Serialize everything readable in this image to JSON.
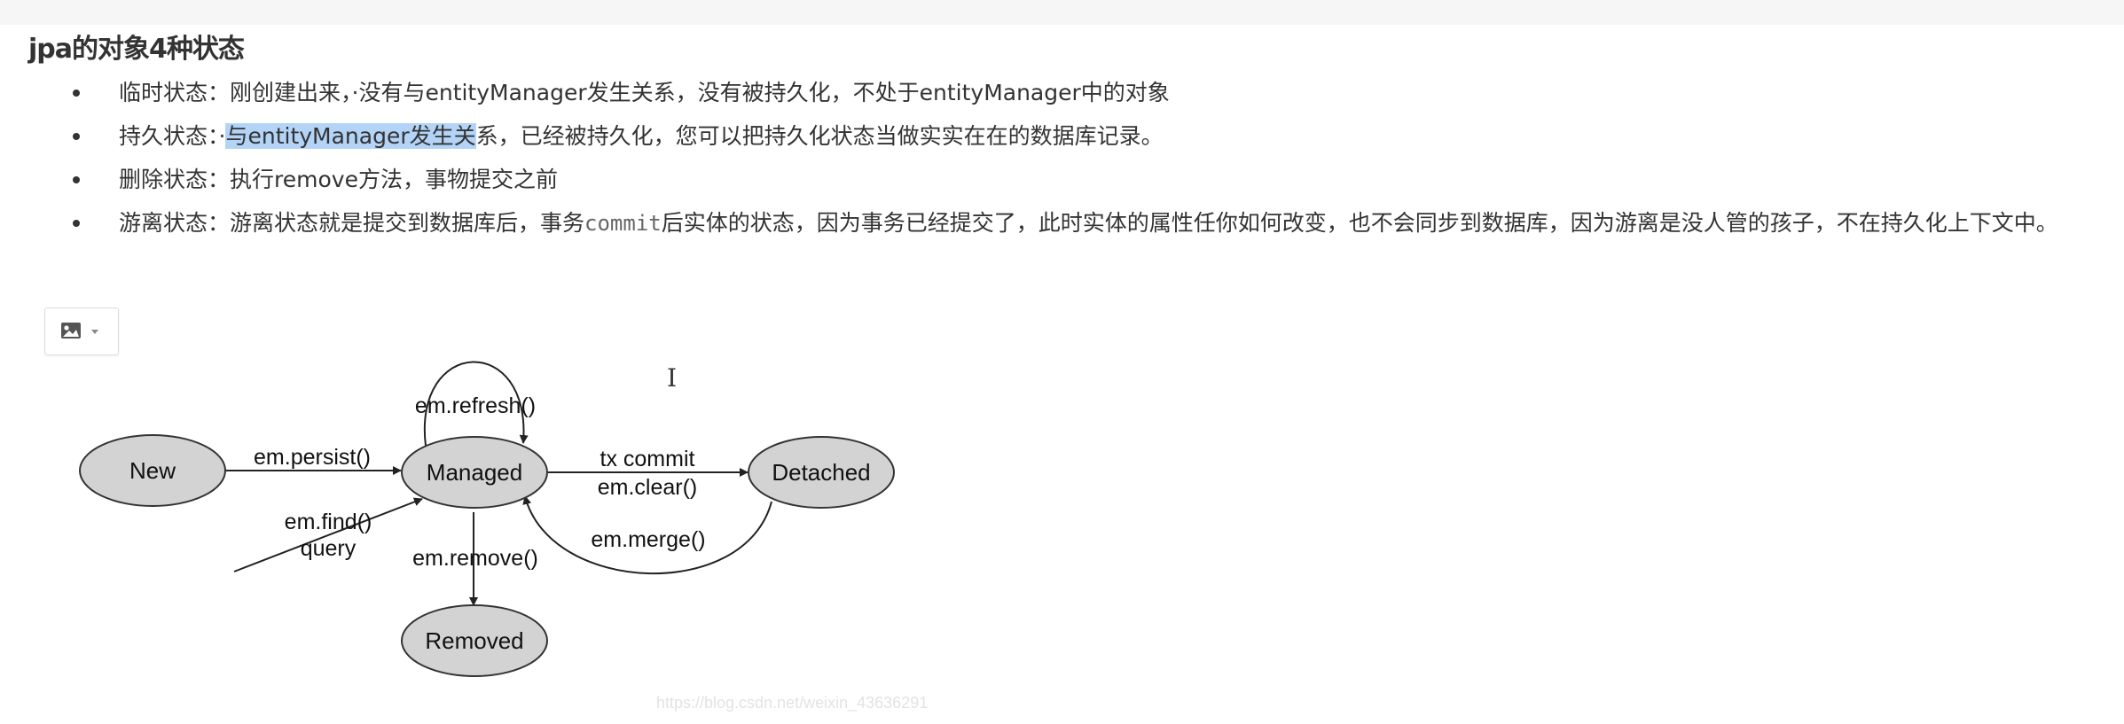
{
  "heading": "jpa的对象4种状态",
  "states": [
    {
      "label": "临时状态：",
      "text": "刚创建出来，·没有与entityManager发生关系，没有被持久化，不处于entityManager中的对象"
    },
    {
      "label": "持久状态：",
      "pre": "·",
      "selected": "与entityManager发生关",
      "post": "系，已经被持久化，您可以把持久化状态当做实实在在的数据库记录。"
    },
    {
      "label": "删除状态：",
      "text": "执行remove方法，事物提交之前"
    },
    {
      "label": "游离状态：",
      "pre": "游离状态就是提交到数据库后，事务",
      "code": "commit",
      "post": "后实体的状态，因为事务已经提交了，此时实体的属性任你如何改变，也不会同步到数据库，因为游离是没人管的孩子，不在持久化上下文中。"
    }
  ],
  "image_toolbar": {
    "icon": "image-icon",
    "dropdown_icon": "caret-down-icon"
  },
  "diagram": {
    "nodes": {
      "new": "New",
      "managed": "Managed",
      "detached": "Detached",
      "removed": "Removed"
    },
    "edges": {
      "persist": "em.persist()",
      "refresh": "em.refresh()",
      "commit": "tx commit",
      "clear": "em.clear()",
      "find": "em.find()",
      "query": "query",
      "remove": "em.remove()",
      "merge": "em.merge()"
    }
  },
  "cursor_glyph": "I",
  "watermark": "https://blog.csdn.net/weixin_43636291",
  "colors": {
    "node_fill": "#d3d3d3",
    "selection": "#b3d4f7",
    "text": "#333333"
  }
}
